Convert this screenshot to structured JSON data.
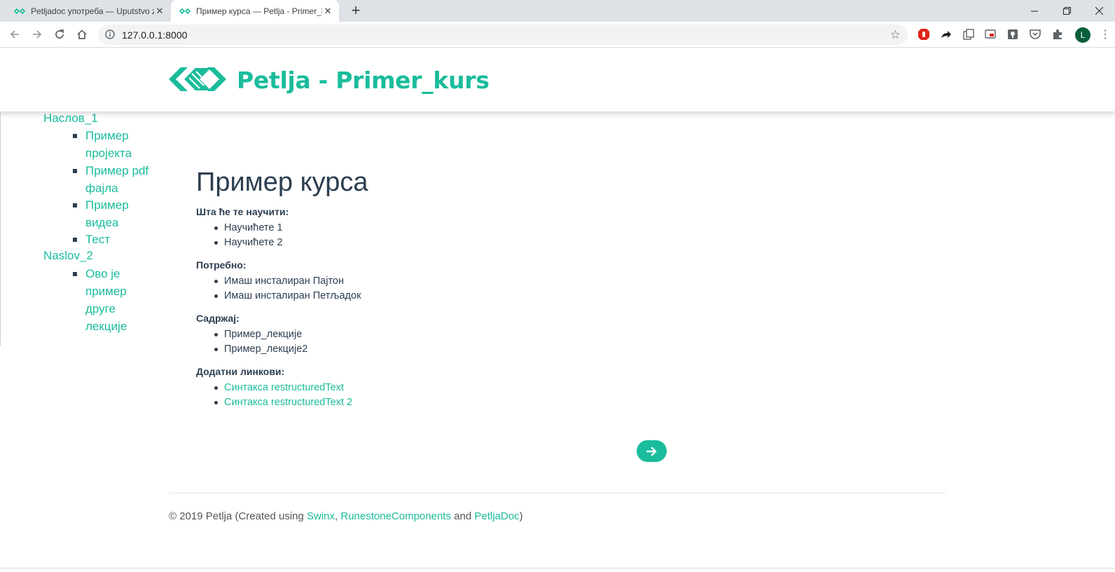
{
  "browser": {
    "tabs": [
      {
        "title": "Petljadoc употреба — Uputstvo za...",
        "active": false
      },
      {
        "title": "Пример курса — Petlja - Primer_kurs",
        "active": true
      }
    ],
    "url": "127.0.0.1:8000",
    "avatar_letter": "L",
    "icons": [
      "back-icon",
      "forward-icon",
      "reload-icon",
      "home-icon",
      "info-icon",
      "star-icon",
      "extensions-icon",
      "menu-icon"
    ]
  },
  "header": {
    "site_title": "Petlja - Primer_kurs",
    "brand_color": "#1abc9c"
  },
  "sidebar": {
    "sections": [
      {
        "title": "Наслов_1",
        "items": [
          {
            "lines": [
              "Пример",
              "пројекта"
            ]
          },
          {
            "lines": [
              "Пример pdf",
              "фајла"
            ]
          },
          {
            "lines": [
              "Пример",
              "видеа"
            ]
          },
          {
            "lines": [
              "Тест"
            ]
          }
        ]
      },
      {
        "title": "Naslov_2",
        "items": [
          {
            "lines": [
              "Ово је",
              "пример",
              "друге",
              "лекције"
            ]
          }
        ]
      }
    ]
  },
  "main": {
    "title": "Пример курса",
    "sections": [
      {
        "heading": "Шта ће те научити:",
        "items": [
          "Научићете 1",
          "Научићете 2"
        ],
        "links": false
      },
      {
        "heading": "Потребно:",
        "items": [
          "Имаш инсталиран Пајтон",
          "Имаш инсталиран Петљадок"
        ],
        "links": false
      },
      {
        "heading": "Садржај:",
        "items": [
          "Пример_лекције",
          "Пример_лекције2"
        ],
        "links": false
      },
      {
        "heading": "Додатни линкови:",
        "items": [
          "Синтакса restructuredText",
          "Синтакса restructuredText 2"
        ],
        "links": true
      }
    ],
    "next_button_icon": "arrow-right-icon"
  },
  "footer": {
    "prefix": "© 2019 Petlja (Created using ",
    "link1": "Swinx",
    "sep1": ", ",
    "link2": "RunestoneComponents",
    "sep2": " and ",
    "link3": "PetljaDoc",
    "suffix": ")"
  }
}
